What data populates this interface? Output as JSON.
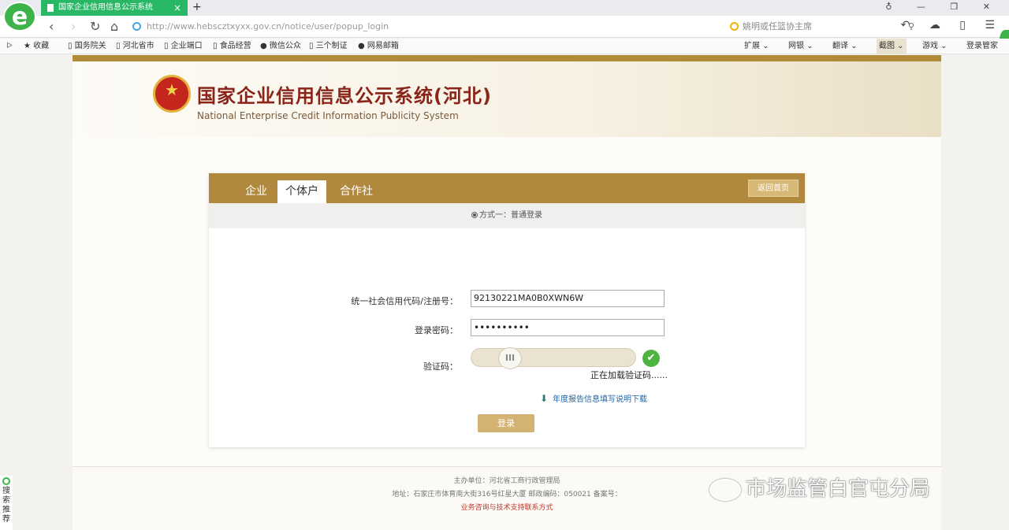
{
  "browser": {
    "tab_title": "国家企业信用信息公示系统",
    "tab_close": "×",
    "new_tab": "+",
    "url_domain": "http://www.hebscztxyxx.gov.cn",
    "url_path": "/notice/user/popup_login",
    "search_placeholder": "姚明或任篮协主席",
    "window_controls": "♁ — ❐ ✕",
    "right_tools": "↶ ☁ ▯ ☰",
    "bookmarks_left": [
      {
        "label": "收藏"
      },
      {
        "label": "国务院关"
      },
      {
        "label": "河北省市"
      },
      {
        "label": "企业端口"
      },
      {
        "label": "食品经营"
      },
      {
        "label": "微信公众"
      },
      {
        "label": "三个制证"
      },
      {
        "label": "网易邮箱"
      }
    ],
    "bookmarks_right": [
      {
        "label": "扩展"
      },
      {
        "label": "网银"
      },
      {
        "label": "翻译"
      },
      {
        "label": "截图"
      },
      {
        "label": "游戏"
      },
      {
        "label": "登录管家"
      }
    ]
  },
  "site": {
    "title_cn": "国家企业信用信息公示系统(河北)",
    "title_en": "National Enterprise Credit Information Publicity System"
  },
  "login": {
    "tabs": [
      {
        "label": "企业"
      },
      {
        "label": "个体户"
      },
      {
        "label": "合作社"
      }
    ],
    "home_button": "返回首页",
    "method": "方式一：普通登录",
    "code_label": "统一社会信用代码/注册号：",
    "code_value": "92130221MA0B0XWN6W",
    "password_label": "登录密码：",
    "password_value": "••••••••••",
    "captcha_label": "验证码：",
    "slider_knob": "III",
    "captcha_ok": "✔",
    "captcha_status": "正在加载验证码......",
    "download_link": "年度报告信息填写说明下载",
    "download_icon": "⬇",
    "login_button": "登录"
  },
  "footer": {
    "sponsor": "主办单位：河北省工商行政管理局",
    "address": "地址：石家庄市体育南大街316号红星大厦 邮政编码：050021 备案号：",
    "support": "业务咨询与技术支持联系方式"
  },
  "side_tool": "搜索推荐",
  "watermark": "市场监管白官屯分局"
}
